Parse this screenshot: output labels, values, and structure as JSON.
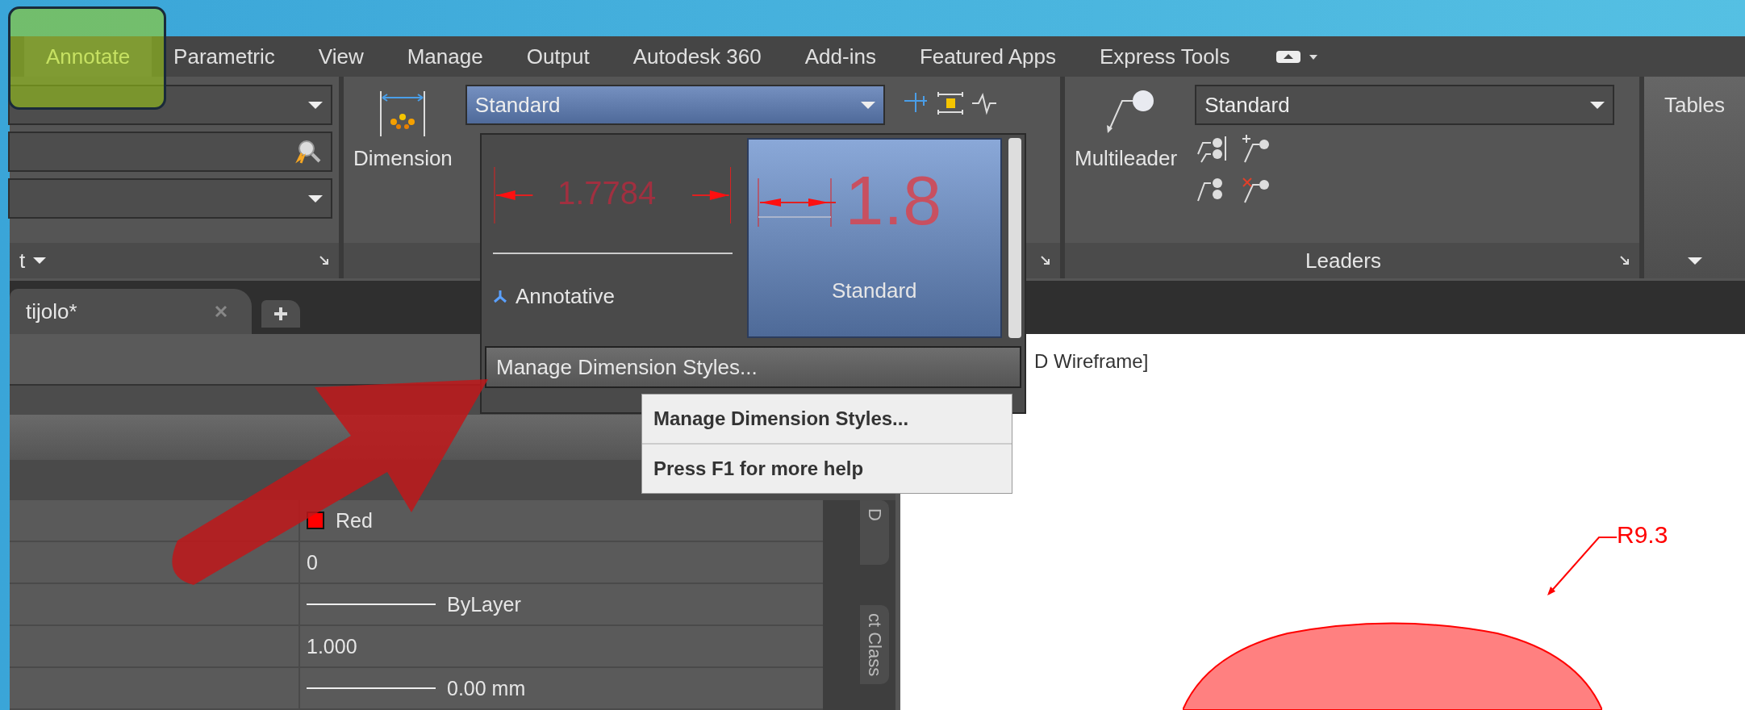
{
  "ribbon_tabs": [
    {
      "label": "Annotate",
      "selected": true
    },
    {
      "label": "Parametric",
      "selected": false
    },
    {
      "label": "View",
      "selected": false
    },
    {
      "label": "Manage",
      "selected": false
    },
    {
      "label": "Output",
      "selected": false
    },
    {
      "label": "Autodesk 360",
      "selected": false
    },
    {
      "label": "Add-ins",
      "selected": false
    },
    {
      "label": "Featured Apps",
      "selected": false
    },
    {
      "label": "Express Tools",
      "selected": false
    }
  ],
  "ribbon": {
    "text_panel": {
      "title": "t"
    },
    "dimensions_panel": {
      "button": "Dimension",
      "style_combo": "Standard"
    },
    "leaders_panel": {
      "button": "Multileader",
      "style_combo": "Standard",
      "title": "Leaders"
    },
    "tables_panel": {
      "button": "Tables"
    }
  },
  "document_tabs": [
    {
      "label": "tijolo*"
    }
  ],
  "dimension_style_gallery": {
    "items": [
      {
        "preview_text": "1.7784",
        "label": "Annotative",
        "annotative": true,
        "selected": false
      },
      {
        "preview_text": "1.8",
        "label": "Standard",
        "annotative": false,
        "selected": true
      }
    ],
    "manage_button": "Manage Dimension Styles..."
  },
  "tooltip": {
    "title": "Manage Dimension Styles...",
    "help": "Press F1 for more help"
  },
  "properties": {
    "rows": [
      {
        "kind": "color",
        "value": "Red",
        "color": "#ff0000"
      },
      {
        "kind": "text",
        "value": "0"
      },
      {
        "kind": "line",
        "value": "ByLayer"
      },
      {
        "kind": "text",
        "value": "1.000"
      },
      {
        "kind": "line",
        "value": "0.00 mm"
      }
    ],
    "side_tabs": [
      "D",
      "ct Class"
    ]
  },
  "drawing": {
    "view_label": "D Wireframe]",
    "dimension": "R9.3"
  }
}
